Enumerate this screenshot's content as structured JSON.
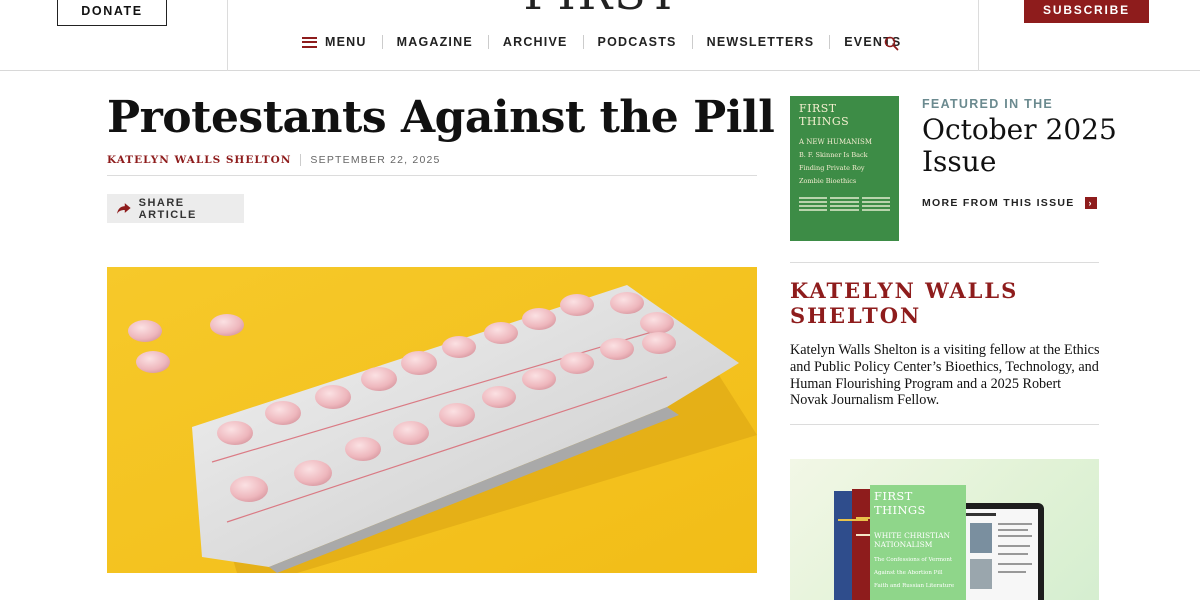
{
  "header": {
    "donate_label": "DONATE",
    "logo_text": "FIRST THINGS",
    "subscribe_label": "SUBSCRIBE",
    "nav": {
      "menu": "MENU",
      "items": [
        "MAGAZINE",
        "ARCHIVE",
        "PODCASTS",
        "NEWSLETTERS",
        "EVENTS"
      ]
    }
  },
  "article": {
    "title": "Protestants Against the Pill",
    "author": "KATELYN WALLS SHELTON",
    "date": "SEPTEMBER 22, 2025",
    "share_label": "SHARE ARTICLE"
  },
  "sidebar": {
    "cover": {
      "title": "FIRST THINGS",
      "headline": "A NEW HUMANISM",
      "lines": [
        "B. F. Skinner Is Back",
        "Finding Private Roy",
        "Zombie Bioethics"
      ]
    },
    "featured_label": "FEATURED IN THE",
    "issue_name": "October 2025 Issue",
    "more_label": "MORE FROM THIS ISSUE",
    "author_name": "KATELYN WALLS SHELTON",
    "author_bio": "Katelyn Walls Shelton is a visiting fellow at the Ethics and Public Policy Center’s Bioethics, Technology, and Human Flourishing Program and a 2025 Robert Novak Journalism Fellow.",
    "promo": {
      "cover_title": "FIRST THINGS",
      "cover_headline": "WHITE CHRISTIAN NATIONALISM",
      "cover_lines": [
        "The Confessions of Vermont",
        "Against the Abortion Pill",
        "Faith and Russian Literature"
      ]
    }
  },
  "colors": {
    "accent": "#8e1c1c",
    "muted_label": "#6b8a8f",
    "cover_green": "#3d8c46",
    "hero_yellow": "#f4c624"
  },
  "icons": {
    "menu": "hamburger-icon",
    "search": "search-icon",
    "share": "share-arrow-icon",
    "more": "chevron-right-icon"
  }
}
